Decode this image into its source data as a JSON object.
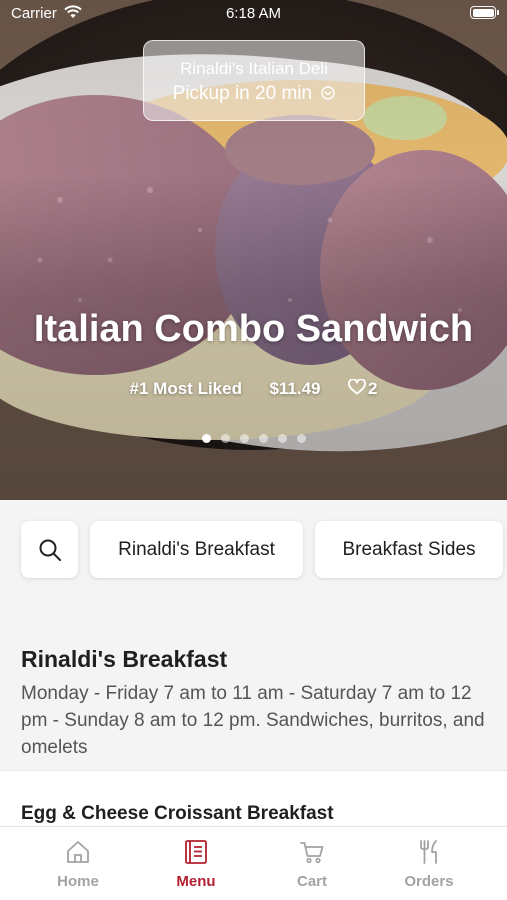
{
  "status_bar": {
    "carrier": "Carrier",
    "time": "6:18 AM"
  },
  "hero": {
    "restaurant_name": "Rinaldi's Italian Deli",
    "pickup_text": "Pickup in 20 min",
    "dish_title": "Italian Combo Sandwich",
    "badge": "#1 Most Liked",
    "price": "$11.49",
    "likes": "2",
    "carousel": {
      "count": 6,
      "active_index": 0
    }
  },
  "categories": {
    "search_icon": "search-icon",
    "items": [
      {
        "label": "Rinaldi's Breakfast"
      },
      {
        "label": "Breakfast Sides"
      }
    ]
  },
  "section": {
    "title": "Rinaldi's Breakfast",
    "description": "Monday - Friday 7 am to 11 am - Saturday 7 am to 12 pm - Sunday 8 am to 12 pm. Sandwiches, burritos, and omelets"
  },
  "first_item": {
    "name": "Egg & Cheese Croissant Breakfast"
  },
  "tab_bar": {
    "tabs": [
      {
        "label": "Home",
        "icon": "home-icon",
        "active": false
      },
      {
        "label": "Menu",
        "icon": "menu-icon",
        "active": true
      },
      {
        "label": "Cart",
        "icon": "cart-icon",
        "active": false
      },
      {
        "label": "Orders",
        "icon": "orders-icon",
        "active": false
      }
    ]
  },
  "colors": {
    "accent": "#b3202f",
    "inactive_tab": "#a3a3a3",
    "background": "#f4f4f4"
  }
}
